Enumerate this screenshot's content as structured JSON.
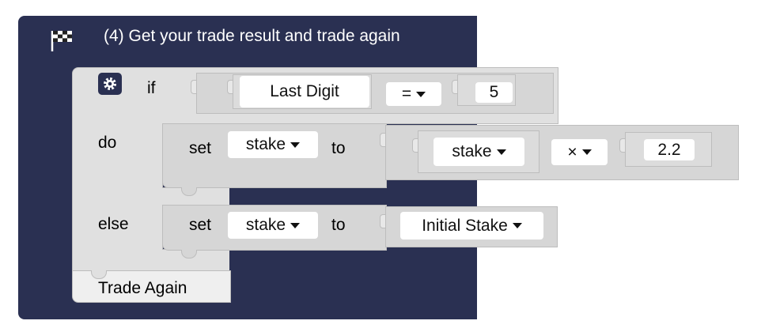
{
  "header": {
    "title": "(4) Get your trade result and trade again",
    "icon": "checkered-flag-icon"
  },
  "if_block": {
    "if_label": "if",
    "do_label": "do",
    "else_label": "else",
    "condition": {
      "left": "Last Digit",
      "operator": "=",
      "right": "5"
    },
    "do_stmt": {
      "set_label": "set",
      "variable": "stake",
      "to_label": "to",
      "expr": {
        "left": "stake",
        "operator": "×",
        "right": "2.2"
      }
    },
    "else_stmt": {
      "set_label": "set",
      "variable": "stake",
      "to_label": "to",
      "value": "Initial Stake"
    }
  },
  "footer_block": {
    "label": "Trade Again"
  },
  "colors": {
    "navy": "#2a3052",
    "block": "#e0e0e0"
  }
}
